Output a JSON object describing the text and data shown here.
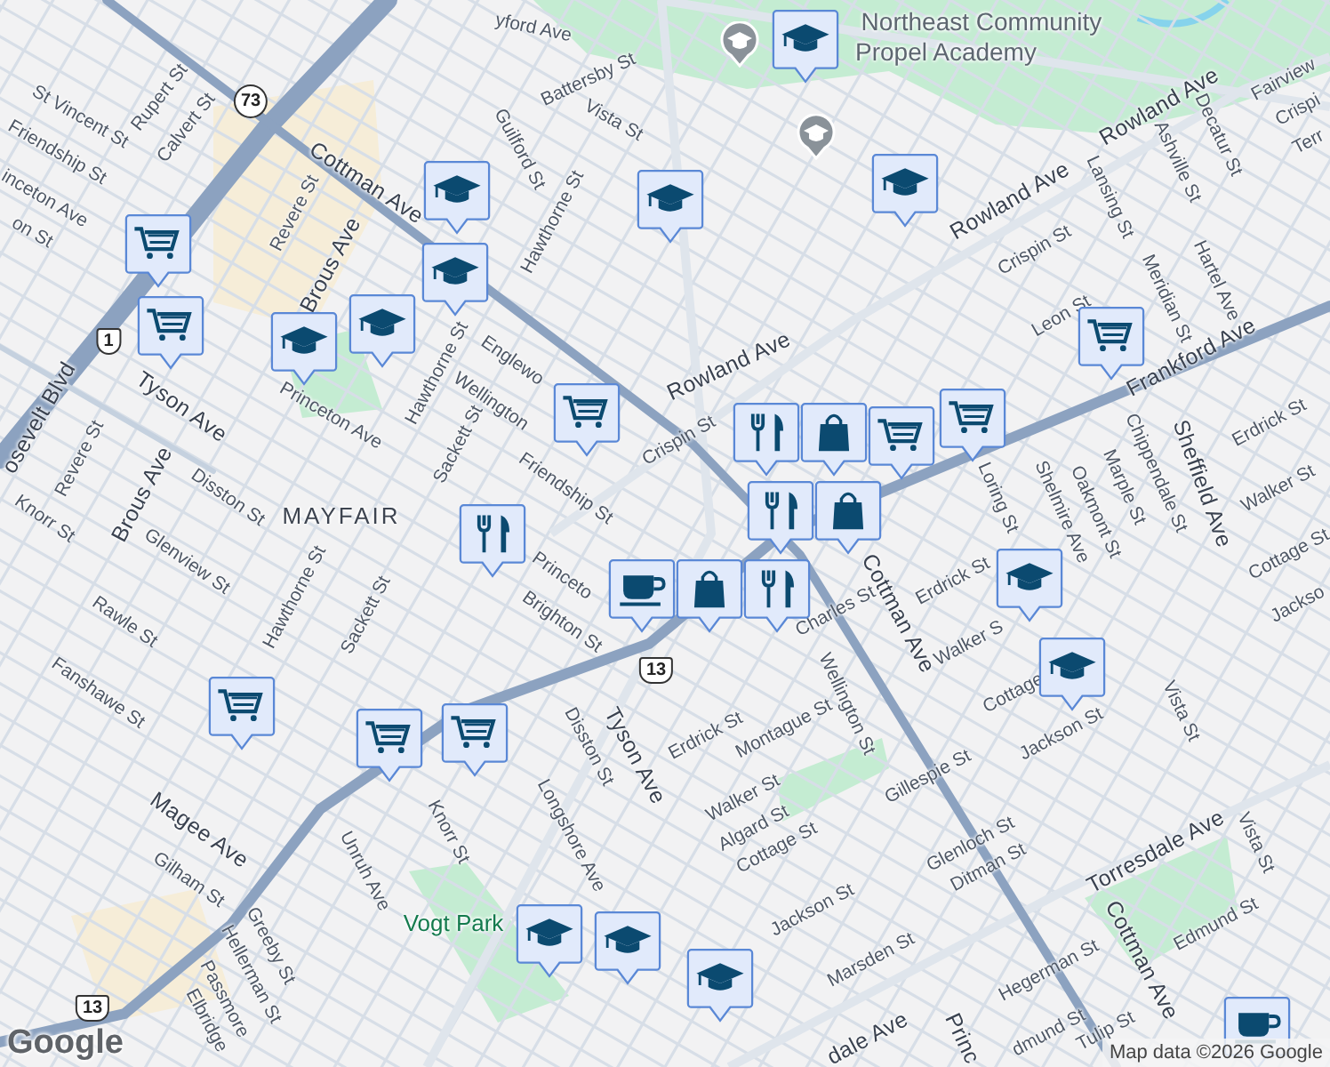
{
  "map": {
    "labels": [
      {
        "text": "yford Ave",
        "kind": "street"
      },
      {
        "text": "St Vincent St",
        "kind": "street"
      },
      {
        "text": "Rupert St",
        "kind": "street"
      },
      {
        "text": "Calvert St",
        "kind": "street"
      },
      {
        "text": "Friendship St",
        "kind": "street"
      },
      {
        "text": "inceton Ave",
        "kind": "street"
      },
      {
        "text": "on St",
        "kind": "street"
      },
      {
        "text": "Cottman Ave",
        "kind": "major"
      },
      {
        "text": "Revere St",
        "kind": "street"
      },
      {
        "text": "Brous Ave",
        "kind": "major"
      },
      {
        "text": "Guilford St",
        "kind": "street"
      },
      {
        "text": "Hawthorne St",
        "kind": "street"
      },
      {
        "text": "Battersby St",
        "kind": "street"
      },
      {
        "text": "Vista St",
        "kind": "street"
      },
      {
        "text": "Tyson Ave",
        "kind": "major"
      },
      {
        "text": "osevelt Blvd",
        "kind": "major"
      },
      {
        "text": "Princeton Ave",
        "kind": "street"
      },
      {
        "text": "Hawthorne St",
        "kind": "street"
      },
      {
        "text": "Englewo",
        "kind": "street"
      },
      {
        "text": "Wellington",
        "kind": "street"
      },
      {
        "text": "Sackett St",
        "kind": "street"
      },
      {
        "text": "Revere St",
        "kind": "street"
      },
      {
        "text": "Disston St",
        "kind": "street"
      },
      {
        "text": "Brous Ave",
        "kind": "major"
      },
      {
        "text": "Knorr St",
        "kind": "street"
      },
      {
        "text": "MAYFAIR",
        "kind": "neighborhood"
      },
      {
        "text": "Friendship St",
        "kind": "street"
      },
      {
        "text": "Glenview St",
        "kind": "street"
      },
      {
        "text": "Hawthorne St",
        "kind": "street"
      },
      {
        "text": "Rawle St",
        "kind": "street"
      },
      {
        "text": "Sackett St",
        "kind": "street"
      },
      {
        "text": "Fanshawe St",
        "kind": "street"
      },
      {
        "text": "Princeto",
        "kind": "street"
      },
      {
        "text": "Brighton St",
        "kind": "street"
      },
      {
        "text": "Magee Ave",
        "kind": "major"
      },
      {
        "text": "Gilham St",
        "kind": "street"
      },
      {
        "text": "Unruh Ave",
        "kind": "street"
      },
      {
        "text": "Knorr St",
        "kind": "street"
      },
      {
        "text": "Longshore Ave",
        "kind": "street"
      },
      {
        "text": "Disston St",
        "kind": "street"
      },
      {
        "text": "Tyson Ave",
        "kind": "major"
      },
      {
        "text": "Vogt Park",
        "kind": "park"
      },
      {
        "text": "Greeby St",
        "kind": "street"
      },
      {
        "text": "Hellerman St",
        "kind": "street"
      },
      {
        "text": "Passmore",
        "kind": "street"
      },
      {
        "text": "Elbridge",
        "kind": "street"
      },
      {
        "text": "Northeast Community",
        "kind": "poi"
      },
      {
        "text": "Propel Academy",
        "kind": "poi"
      },
      {
        "text": "Rowland Ave",
        "kind": "major"
      },
      {
        "text": "Rowland Ave",
        "kind": "major"
      },
      {
        "text": "Rowland Ave",
        "kind": "major"
      },
      {
        "text": "Crispin St",
        "kind": "street"
      },
      {
        "text": "Lansing St",
        "kind": "street"
      },
      {
        "text": "Ashville St",
        "kind": "street"
      },
      {
        "text": "Decatur St",
        "kind": "street"
      },
      {
        "text": "Fairview",
        "kind": "street"
      },
      {
        "text": "Crispi",
        "kind": "street"
      },
      {
        "text": "Terr",
        "kind": "street"
      },
      {
        "text": "Leon St",
        "kind": "street"
      },
      {
        "text": "Meridian St",
        "kind": "street"
      },
      {
        "text": "Hartel Ave",
        "kind": "street"
      },
      {
        "text": "Frankford Ave",
        "kind": "major"
      },
      {
        "text": "Crispin St",
        "kind": "street"
      },
      {
        "text": "Sheffield Ave",
        "kind": "major"
      },
      {
        "text": "Chippendale St",
        "kind": "street"
      },
      {
        "text": "Marple St",
        "kind": "street"
      },
      {
        "text": "Oakmont St",
        "kind": "street"
      },
      {
        "text": "Shelmire Ave",
        "kind": "street"
      },
      {
        "text": "Loring St",
        "kind": "street"
      },
      {
        "text": "Erdrick St",
        "kind": "street"
      },
      {
        "text": "Walker St",
        "kind": "street"
      },
      {
        "text": "Cottage St",
        "kind": "street"
      },
      {
        "text": "Jackso",
        "kind": "street"
      },
      {
        "text": "Cottman Ave",
        "kind": "major"
      },
      {
        "text": "Cottman Ave",
        "kind": "major"
      },
      {
        "text": "Charles St",
        "kind": "street"
      },
      {
        "text": "Wellington St",
        "kind": "street"
      },
      {
        "text": "Erdrick St",
        "kind": "street"
      },
      {
        "text": "Erdrick St",
        "kind": "street"
      },
      {
        "text": "Walker S",
        "kind": "street"
      },
      {
        "text": "Montague St",
        "kind": "street"
      },
      {
        "text": "Cottage",
        "kind": "street"
      },
      {
        "text": "Jackson St",
        "kind": "street"
      },
      {
        "text": "Vista St",
        "kind": "street"
      },
      {
        "text": "Vista St",
        "kind": "street"
      },
      {
        "text": "Walker St",
        "kind": "street"
      },
      {
        "text": "Algard St",
        "kind": "street"
      },
      {
        "text": "Gillespie St",
        "kind": "street"
      },
      {
        "text": "Cottage St",
        "kind": "street"
      },
      {
        "text": "Glenloch St",
        "kind": "street"
      },
      {
        "text": "Ditman St",
        "kind": "street"
      },
      {
        "text": "Jackson St",
        "kind": "street"
      },
      {
        "text": "Torresdale Ave",
        "kind": "major"
      },
      {
        "text": "Edmund St",
        "kind": "street"
      },
      {
        "text": "Marsden St",
        "kind": "street"
      },
      {
        "text": "Hegerman St",
        "kind": "street"
      },
      {
        "text": "dmund St",
        "kind": "street"
      },
      {
        "text": "Tulip St",
        "kind": "street"
      },
      {
        "text": "dale Ave",
        "kind": "major"
      },
      {
        "text": "Princ",
        "kind": "major"
      }
    ],
    "shields": [
      {
        "text": "73",
        "kind": "state"
      },
      {
        "text": "1",
        "kind": "us"
      },
      {
        "text": "13",
        "kind": "us"
      },
      {
        "text": "13",
        "kind": "us"
      }
    ],
    "pins": [
      {
        "kind": "school-small"
      },
      {
        "kind": "school-small"
      },
      {
        "kind": "school"
      },
      {
        "kind": "school"
      },
      {
        "kind": "school"
      },
      {
        "kind": "school"
      },
      {
        "kind": "school"
      },
      {
        "kind": "school"
      },
      {
        "kind": "school"
      },
      {
        "kind": "school"
      },
      {
        "kind": "school"
      },
      {
        "kind": "school"
      },
      {
        "kind": "school"
      },
      {
        "kind": "school"
      },
      {
        "kind": "grocery"
      },
      {
        "kind": "grocery"
      },
      {
        "kind": "grocery"
      },
      {
        "kind": "grocery"
      },
      {
        "kind": "grocery"
      },
      {
        "kind": "grocery"
      },
      {
        "kind": "grocery"
      },
      {
        "kind": "restaurant"
      },
      {
        "kind": "restaurant"
      },
      {
        "kind": "shopping"
      },
      {
        "kind": "grocery"
      },
      {
        "kind": "grocery"
      },
      {
        "kind": "restaurant"
      },
      {
        "kind": "shopping"
      },
      {
        "kind": "cafe"
      },
      {
        "kind": "shopping"
      },
      {
        "kind": "restaurant"
      },
      {
        "kind": "cafe"
      }
    ],
    "logo": "Google",
    "attribution": "Map data ©2026 Google"
  }
}
